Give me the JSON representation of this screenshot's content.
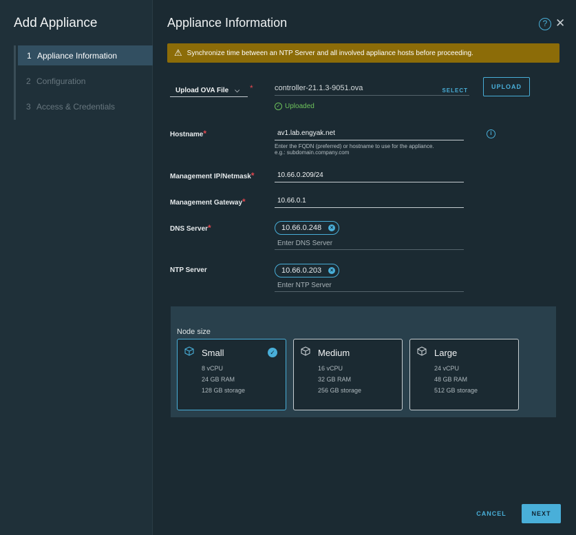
{
  "sidebar": {
    "title": "Add Appliance",
    "steps": [
      {
        "num": "1",
        "label": "Appliance Information"
      },
      {
        "num": "2",
        "label": "Configuration"
      },
      {
        "num": "3",
        "label": "Access & Credentials"
      }
    ]
  },
  "header": {
    "title": "Appliance Information",
    "help_glyph": "?",
    "close_glyph": "✕"
  },
  "alert": {
    "text": "Synchronize time between an NTP Server and all involved appliance hosts before proceeding.",
    "icon": "warning-icon"
  },
  "upload": {
    "mode_label": "Upload OVA File",
    "required_mark": "*",
    "file_name": "controller-21.1.3-9051.ova",
    "select_label": "SELECT",
    "upload_label": "UPLOAD",
    "status": "Uploaded"
  },
  "fields": {
    "hostname": {
      "label": "Hostname",
      "value": "av1.lab.engyak.net",
      "helper_line1": "Enter the FQDN (preferred) or hostname to use for the appliance.",
      "helper_line2": "e.g.: subdomain.company.com"
    },
    "mgmt_ip": {
      "label": "Management IP/Netmask",
      "value": "10.66.0.209/24"
    },
    "mgmt_gw": {
      "label": "Management Gateway",
      "value": "10.66.0.1"
    },
    "dns": {
      "label": "DNS Server",
      "chip": "10.66.0.248",
      "placeholder": "Enter DNS Server"
    },
    "ntp": {
      "label": "NTP Server",
      "chip": "10.66.0.203",
      "placeholder": "Enter NTP Server"
    }
  },
  "node_size": {
    "title": "Node size",
    "options": [
      {
        "name": "Small",
        "cpu": "8 vCPU",
        "ram": "24 GB RAM",
        "storage": "128 GB storage",
        "selected": true
      },
      {
        "name": "Medium",
        "cpu": "16 vCPU",
        "ram": "32 GB RAM",
        "storage": "256 GB storage",
        "selected": false
      },
      {
        "name": "Large",
        "cpu": "24 vCPU",
        "ram": "48 GB RAM",
        "storage": "512 GB storage",
        "selected": false
      }
    ]
  },
  "footer": {
    "cancel_label": "CANCEL",
    "next_label": "NEXT"
  },
  "colors": {
    "accent": "#49afd9",
    "warning_bg": "#8c6c08",
    "success": "#6ec35c",
    "required": "#e2474f"
  }
}
